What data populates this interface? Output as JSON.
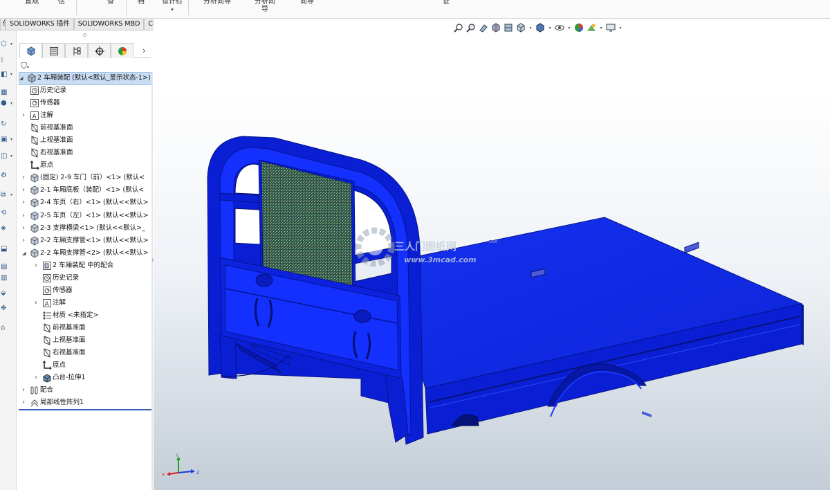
{
  "ribbon": {
    "fragments": [
      "直观",
      "估",
      "查",
      "档",
      "设计检",
      "分析向导",
      "分析向",
      "导",
      "向导",
      "证"
    ]
  },
  "tabs": [
    {
      "label": "估"
    },
    {
      "label": "SOLIDWORKS 插件"
    },
    {
      "label": "SOLIDWORKS MBD"
    },
    {
      "label": "CircuitWorks"
    }
  ],
  "feature_tree": {
    "root": "2 车厢装配  (默认<默认_显示状态-1>)",
    "items": [
      {
        "label": "历史记录",
        "icon": "history-icon",
        "indent": 0
      },
      {
        "label": "传感器",
        "icon": "sensor-icon",
        "indent": 0
      },
      {
        "label": "注解",
        "icon": "annotation-icon",
        "indent": 0
      },
      {
        "label": "前视基准面",
        "icon": "plane-icon",
        "indent": 0
      },
      {
        "label": "上视基准面",
        "icon": "plane-icon",
        "indent": 0
      },
      {
        "label": "右视基准面",
        "icon": "plane-icon",
        "indent": 0
      },
      {
        "label": "原点",
        "icon": "origin-icon",
        "indent": 0
      },
      {
        "label": "(固定) 2-9 车门（前）<1> (默认<",
        "icon": "part-icon",
        "indent": 0
      },
      {
        "label": "2-1 车厢底板（装配）<1> (默认<",
        "icon": "part-icon",
        "indent": 0
      },
      {
        "label": "2-4 车页（右）<1> (默认<<默认>",
        "icon": "part-icon",
        "indent": 0
      },
      {
        "label": "2-5 车页（左）<1> (默认<<默认>",
        "icon": "part-icon",
        "indent": 0
      },
      {
        "label": "2-3 支撑横梁<1> (默认<<默认>_",
        "icon": "part-icon",
        "indent": 0
      },
      {
        "label": "2-2 车厢支撑管<1> (默认<<默认>",
        "icon": "part-icon",
        "indent": 0
      },
      {
        "label": "2-2 车厢支撑管<2> (默认<<默认>",
        "icon": "part-icon",
        "indent": 0
      },
      {
        "label": "2 车厢装配 中的配合",
        "icon": "mate-folder-icon",
        "indent": 1
      },
      {
        "label": "历史记录",
        "icon": "history-icon",
        "indent": 1
      },
      {
        "label": "传感器",
        "icon": "sensor-icon",
        "indent": 1
      },
      {
        "label": "注解",
        "icon": "annotation-icon",
        "indent": 1
      },
      {
        "label": "材质 <未指定>",
        "icon": "material-icon",
        "indent": 1
      },
      {
        "label": "前视基准面",
        "icon": "plane-icon",
        "indent": 1
      },
      {
        "label": "上视基准面",
        "icon": "plane-icon",
        "indent": 1
      },
      {
        "label": "右视基准面",
        "icon": "plane-icon",
        "indent": 1
      },
      {
        "label": "原点",
        "icon": "origin-icon",
        "indent": 1
      },
      {
        "label": "凸台-拉伸1",
        "icon": "extrude-icon",
        "indent": 1
      },
      {
        "label": "配合",
        "icon": "mates-icon",
        "indent": 0
      },
      {
        "label": "局部线性阵列1",
        "icon": "pattern-icon",
        "indent": 0
      }
    ]
  },
  "watermark": {
    "line1": "三人门图纸网",
    "line2": "www.3mcad.com"
  },
  "triad": {
    "x": "X",
    "y": "Y",
    "z": "Z"
  },
  "colors": {
    "model_blue": "#0a1fd4",
    "model_dark": "#021093",
    "selection": "#c9def4",
    "accent": "#2e5fb4"
  }
}
